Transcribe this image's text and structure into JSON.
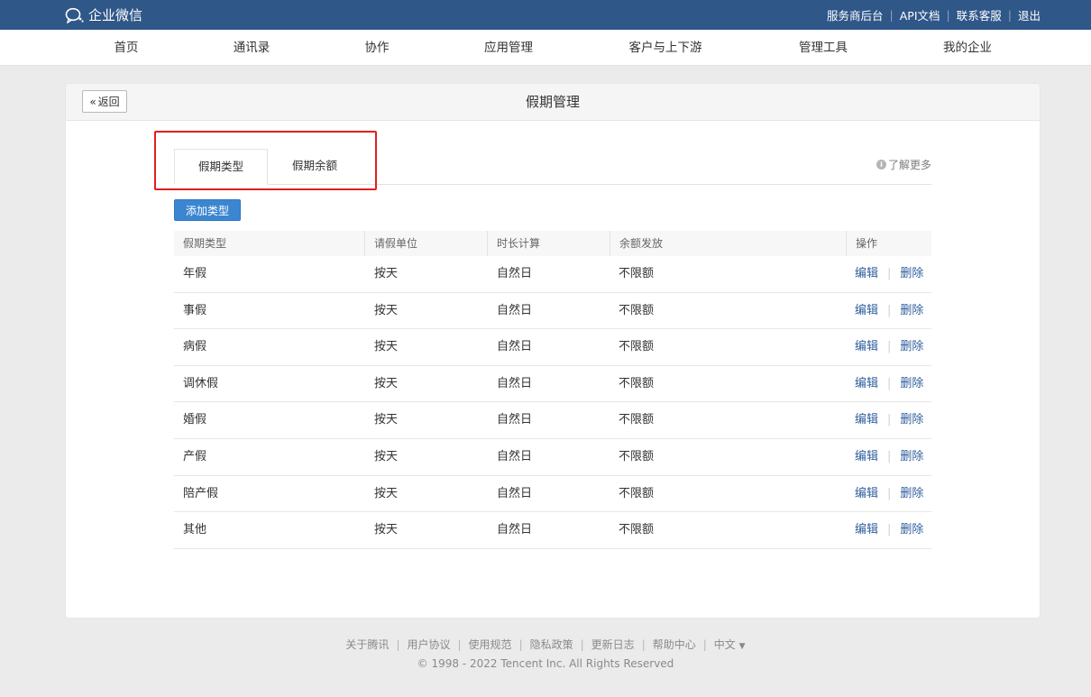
{
  "topbar": {
    "logo_text": "企业微信",
    "links": [
      "服务商后台",
      "API文档",
      "联系客服",
      "退出"
    ]
  },
  "nav": {
    "items": [
      "首页",
      "通讯录",
      "协作",
      "应用管理",
      "客户与上下游",
      "管理工具",
      "我的企业"
    ]
  },
  "page": {
    "back_label": "返回",
    "title": "假期管理",
    "learn_more": "了解更多"
  },
  "tabs": [
    {
      "label": "假期类型",
      "active": true
    },
    {
      "label": "假期余额",
      "active": false
    }
  ],
  "add_button": "添加类型",
  "table": {
    "headers": [
      "假期类型",
      "请假单位",
      "时长计算",
      "余额发放",
      "操作"
    ],
    "rows": [
      {
        "type": "年假",
        "unit": "按天",
        "calc": "自然日",
        "balance": "不限额"
      },
      {
        "type": "事假",
        "unit": "按天",
        "calc": "自然日",
        "balance": "不限额"
      },
      {
        "type": "病假",
        "unit": "按天",
        "calc": "自然日",
        "balance": "不限额"
      },
      {
        "type": "调休假",
        "unit": "按天",
        "calc": "自然日",
        "balance": "不限额"
      },
      {
        "type": "婚假",
        "unit": "按天",
        "calc": "自然日",
        "balance": "不限额"
      },
      {
        "type": "产假",
        "unit": "按天",
        "calc": "自然日",
        "balance": "不限额"
      },
      {
        "type": "陪产假",
        "unit": "按天",
        "calc": "自然日",
        "balance": "不限额"
      },
      {
        "type": "其他",
        "unit": "按天",
        "calc": "自然日",
        "balance": "不限额"
      }
    ],
    "edit_label": "编辑",
    "delete_label": "删除"
  },
  "footer": {
    "links": [
      "关于腾讯",
      "用户协议",
      "使用规范",
      "隐私政策",
      "更新日志",
      "帮助中心"
    ],
    "language": "中文",
    "copyright": "© 1998 - 2022 Tencent Inc. All Rights Reserved"
  },
  "colors": {
    "topbar": "#2f5788",
    "accent_button": "#3b86d1",
    "highlight": "#e01f1f",
    "link": "#2f5f9e"
  }
}
